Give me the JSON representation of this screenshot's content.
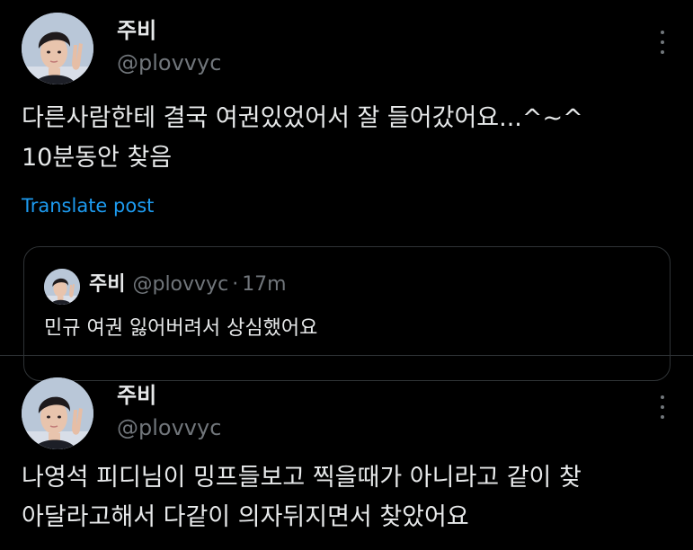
{
  "posts": [
    {
      "author": {
        "display_name": "주비",
        "handle": "@plovvyc"
      },
      "text": "다른사람한테 결국 여권있었어서 잘 들어갔어요...^~^\n10분동안 찾음",
      "translate_label": "Translate post",
      "quote": {
        "author": {
          "display_name": "주비",
          "handle": "@plovvyc"
        },
        "separator": "·",
        "time": "17m",
        "text": "민규 여권 잃어버려서 상심했어요"
      }
    },
    {
      "author": {
        "display_name": "주비",
        "handle": "@plovvyc"
      },
      "text": "나영석 피디님이 밍프들보고 찍을때가 아니라고 같이 찾\n아달라고해서 다같이 의자뒤지면서 찾았어요"
    }
  ],
  "icons": {
    "more": "more-options-icon",
    "avatar": "profile-avatar"
  },
  "colors": {
    "background": "#000000",
    "primary_text": "#e7e9ea",
    "secondary_text": "#71767b",
    "link": "#1d9bf0",
    "border": "#2f3336"
  }
}
